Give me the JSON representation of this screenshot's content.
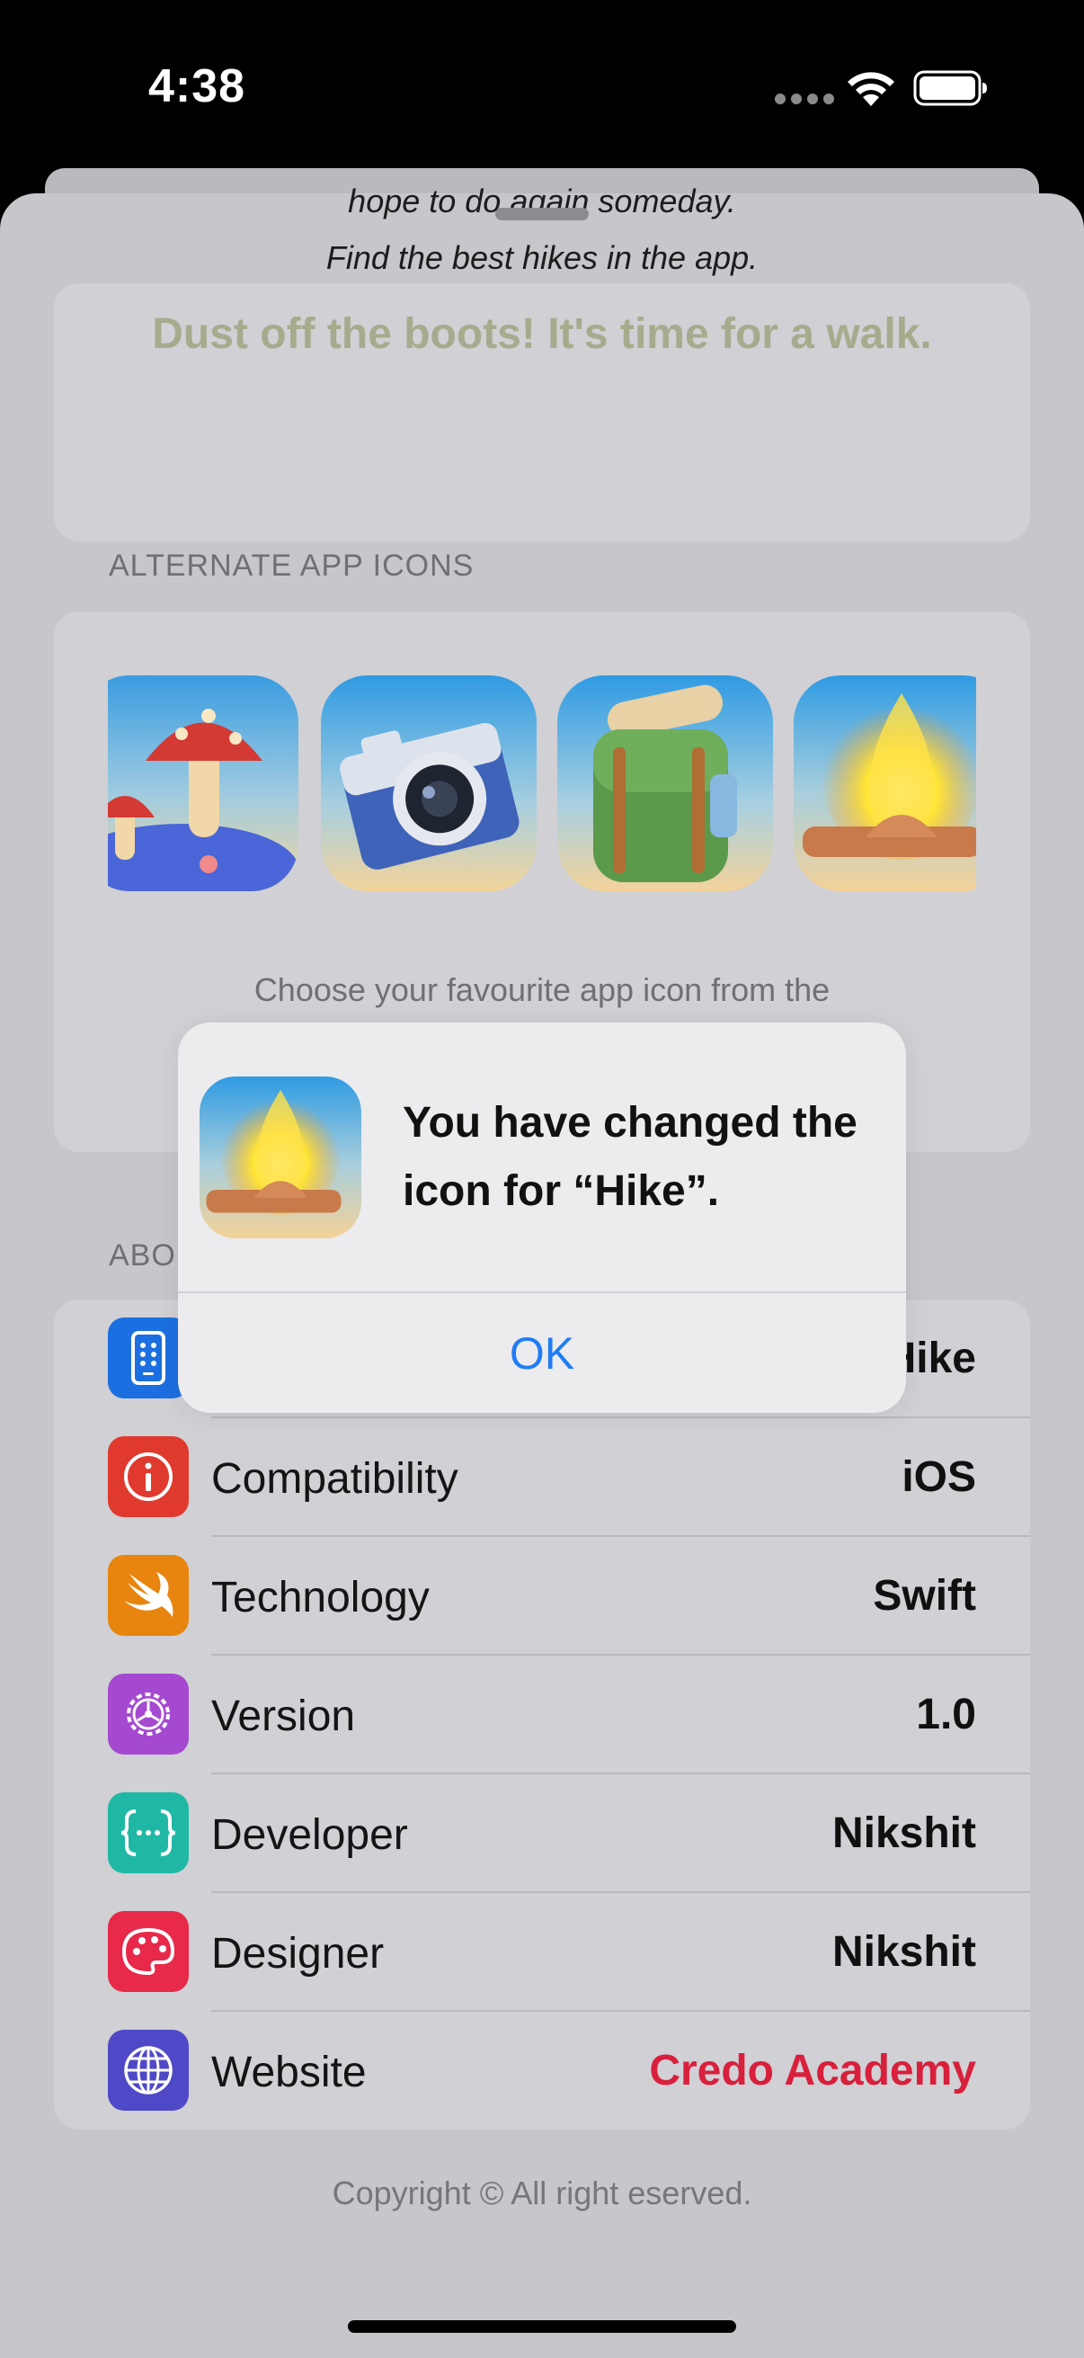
{
  "status_bar": {
    "time": "4:38"
  },
  "intro": {
    "hope_line": "hope to do again someday.",
    "find_line": "Find the best hikes in the app.",
    "dust_line": "Dust off the boots! It's time for a walk."
  },
  "alternate_icons": {
    "header": "ALTERNATE APP ICONS",
    "icons": [
      "mushroom-icon",
      "camera-icon",
      "backpack-icon",
      "campfire-icon"
    ],
    "choose_text": "Choose your favourite app icon from the"
  },
  "about": {
    "header_visible": "ABO",
    "rows": [
      {
        "label": "",
        "value": "Hike",
        "icon": "app-icon",
        "color": "#1c6fe0"
      },
      {
        "label": "Compatibility",
        "value": "iOS",
        "icon": "info-icon",
        "color": "#e03a2f"
      },
      {
        "label": "Technology",
        "value": "Swift",
        "icon": "swift-icon",
        "color": "#e8850e"
      },
      {
        "label": "Version",
        "value": "1.0",
        "icon": "gear-icon",
        "color": "#a549d1"
      },
      {
        "label": "Developer",
        "value": "Nikshit",
        "icon": "curly-braces-icon",
        "color": "#1fb8a5"
      },
      {
        "label": "Designer",
        "value": "Nikshit",
        "icon": "palette-icon",
        "color": "#e8294a"
      },
      {
        "label": "Website",
        "value": "Credo Academy",
        "icon": "globe-icon",
        "color": "#4f48c7"
      }
    ],
    "website_color": "#d8203c"
  },
  "footer": {
    "copyright": "Copyright © All right eserved."
  },
  "alert": {
    "message": "You have changed the icon for “Hike”.",
    "ok_label": "OK",
    "accent": "#1f7cf5"
  }
}
